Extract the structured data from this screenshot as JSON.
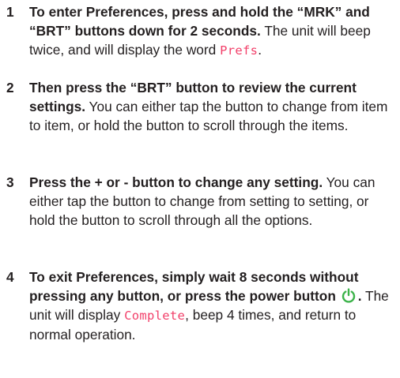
{
  "accent_color": "#f2406a",
  "icon_color": "#3cb34a",
  "steps": [
    {
      "number": "1",
      "bold": "To enter Preferences, press and hold the “MRK” and “BRT” buttons down for 2 seconds.",
      "text": " The unit will beep twice, and will display the word ",
      "display": "Prefs",
      "end": "."
    },
    {
      "number": "2",
      "bold": "Then press the “BRT” button to review the current settings.",
      "text": " You can either tap the button to change from item to item, or hold the button to scroll through the items."
    },
    {
      "number": "3",
      "bold": "Press the + or - button to change any setting.",
      "text": " You can either tap the button to change from setting to setting, or hold the button to scroll through all the options."
    },
    {
      "number": "4",
      "bold": "To exit Preferences, simply wait 8 seconds without pressing any button, or press the power button",
      "icon": "power-icon",
      "bold_end": ".",
      "text": " The unit will display ",
      "display": "Complete",
      "end": ", beep 4 times, and return to normal operation."
    }
  ]
}
